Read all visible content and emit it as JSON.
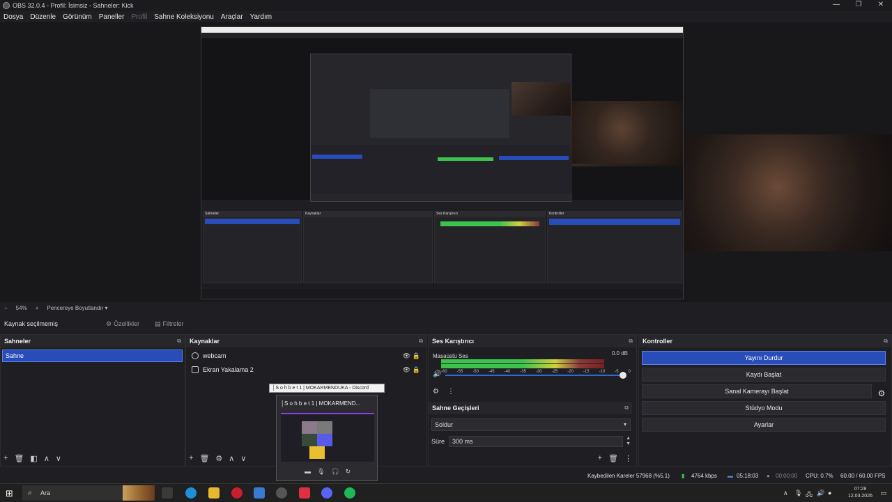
{
  "window": {
    "title": "OBS 32.0.4 - Profil: İsimsiz - Sahneler: Kick"
  },
  "window_controls": {
    "minimize": "—",
    "maximize": "❐",
    "close": "✕"
  },
  "menu": [
    "Dosya",
    "Düzenle",
    "Görünüm",
    "Paneller",
    "Profil",
    "Sahne Koleksiyonu",
    "Araçlar",
    "Yardım"
  ],
  "zoom": {
    "level": "54%",
    "mode": "Pencereye Boyutlandır"
  },
  "source_bar": {
    "no_source": "Kaynak seçilmemiş",
    "properties": "Özellikler",
    "filters": "Filtreler"
  },
  "scenes": {
    "title": "Sahneler",
    "items": [
      "Sahne"
    ]
  },
  "sources": {
    "title": "Kaynaklar",
    "items": [
      {
        "name": "webcam",
        "icon": "camera-icon"
      },
      {
        "name": "Ekran Yakalama 2",
        "icon": "monitor-icon"
      }
    ]
  },
  "mixer": {
    "title": "Ses Karıştırıcı",
    "channel": "Masaüstü Ses",
    "db": "0.0 dB",
    "ticks": [
      "-60",
      "-55",
      "-50",
      "-45",
      "-40",
      "-35",
      "-30",
      "-25",
      "-20",
      "-15",
      "-10",
      "-5",
      "0"
    ]
  },
  "transitions": {
    "title": "Sahne Geçişleri",
    "selected": "Soldur",
    "duration_label": "Süre",
    "duration_value": "300 ms"
  },
  "controls": {
    "title": "Kontroller",
    "stop_stream": "Yayını Durdur",
    "start_record": "Kaydı Başlat",
    "virtual_cam": "Sanal Kamerayı Başlat",
    "studio_mode": "Stüdyo Modu",
    "settings": "Ayarlar"
  },
  "status": {
    "dropped": "Kaybedilen Kareler 57968 (%5.1)",
    "bitrate": "4764 kbps",
    "stream_time": "05:18:03",
    "rec_time": "00:00:00",
    "cpu": "CPU: 0.7%",
    "fps": "60.00 / 60.00 FPS"
  },
  "discord_popup": {
    "tooltip": "│S o h b e t 1 | MOKARMENDUKA - Discord",
    "title": "│S o h b e t 1 | MOKARMEND..."
  },
  "taskbar": {
    "search_placeholder": "Ara",
    "time": "07:28",
    "date": "12.03.2026"
  },
  "colors": {
    "accent": "#284cb8",
    "meter_green": "#3ec24e",
    "meter_yellow": "#cfcf40",
    "meter_red": "#8a3a3a"
  }
}
